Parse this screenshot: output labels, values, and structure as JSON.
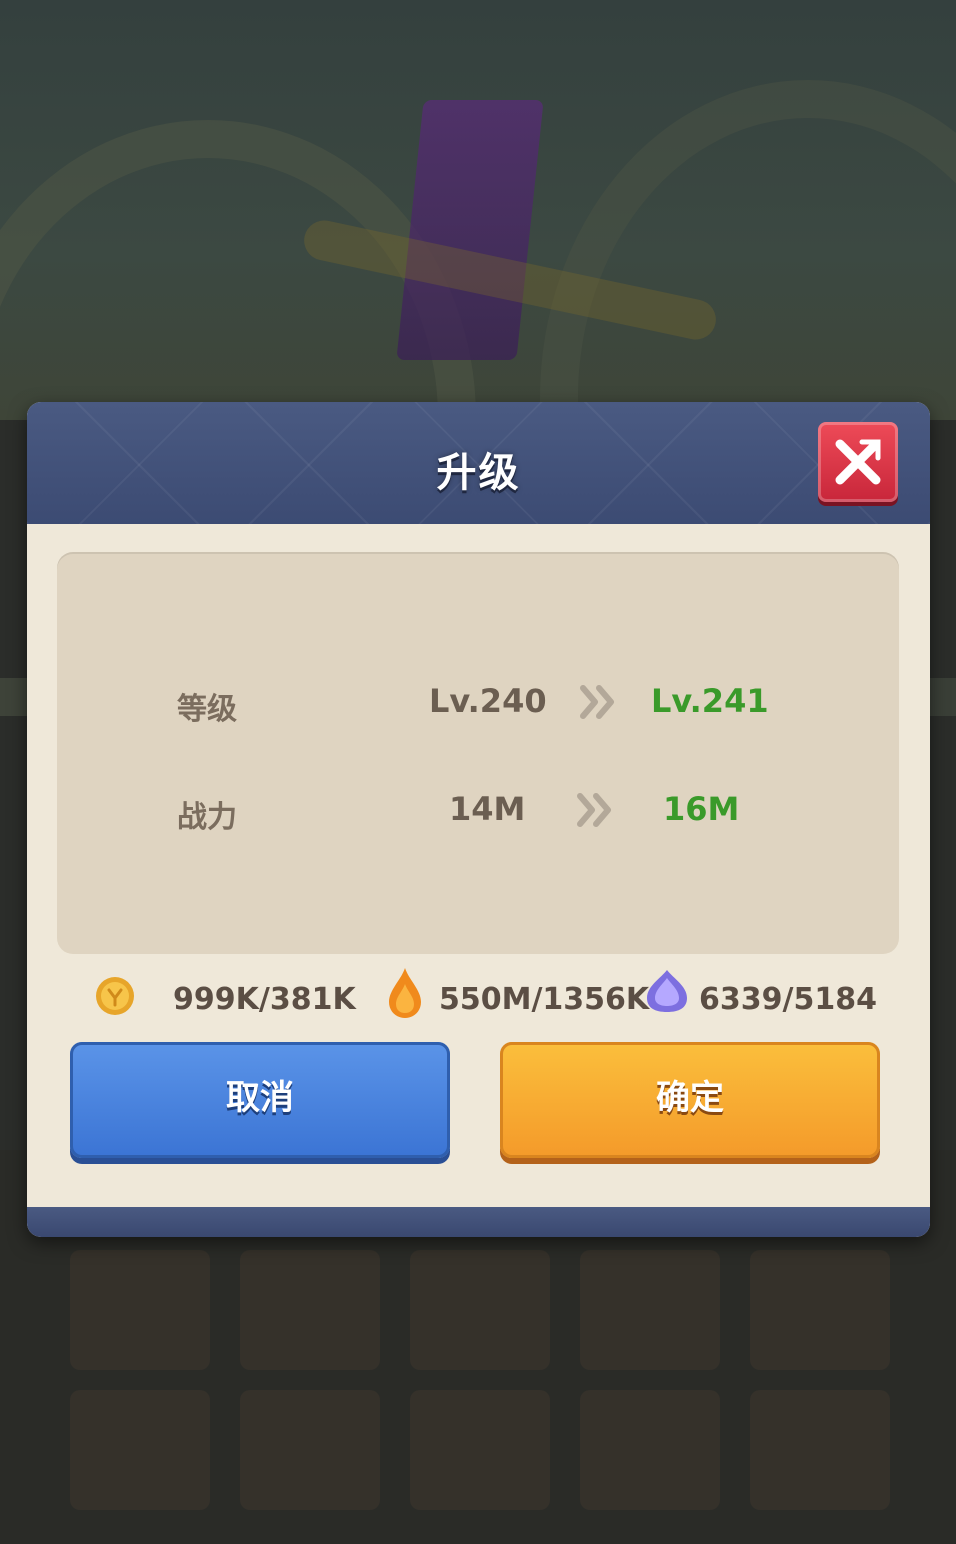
{
  "dialog": {
    "title": "升级",
    "close_icon": "close-x-icon"
  },
  "stats": [
    {
      "label": "等级",
      "old": "Lv.240",
      "new": "Lv.241"
    },
    {
      "label": "战力",
      "old": "14M",
      "new": "16M"
    }
  ],
  "resources": [
    {
      "icon": "gold-coin-icon",
      "value": "999K/381K"
    },
    {
      "icon": "fire-essence-icon",
      "value": "550M/1356K"
    },
    {
      "icon": "purple-crystal-icon",
      "value": "6339/5184"
    }
  ],
  "buttons": {
    "cancel": "取消",
    "confirm": "确定"
  },
  "colors": {
    "header": "#3c4b73",
    "close": "#d93445",
    "increase": "#3a9a2a",
    "cancel": "#3b74d4",
    "confirm": "#f49a2a"
  }
}
